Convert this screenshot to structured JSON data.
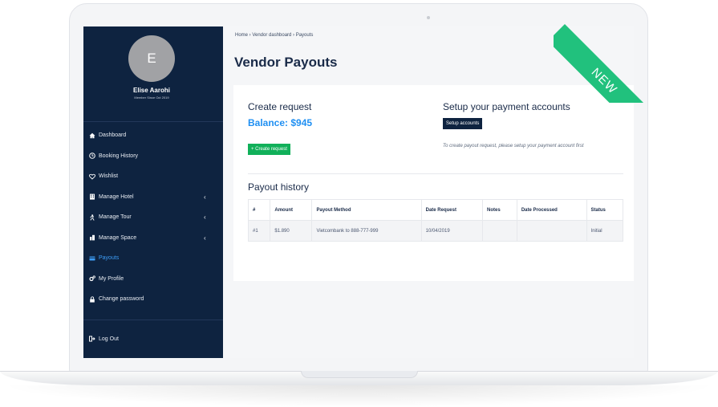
{
  "user": {
    "initial": "E",
    "name": "Elise Aarohi",
    "member_since": "Member Since Oct 2019"
  },
  "sidebar": {
    "items": [
      {
        "label": "Dashboard",
        "icon": "home-icon",
        "caret": false,
        "active": false
      },
      {
        "label": "Booking History",
        "icon": "clock-icon",
        "caret": false,
        "active": false
      },
      {
        "label": "Wishlist",
        "icon": "heart-icon",
        "caret": false,
        "active": false
      },
      {
        "label": "Manage Hotel",
        "icon": "building-icon",
        "caret": true,
        "active": false
      },
      {
        "label": "Manage Tour",
        "icon": "tour-icon",
        "caret": true,
        "active": false
      },
      {
        "label": "Manage Space",
        "icon": "space-icon",
        "caret": true,
        "active": false
      },
      {
        "label": "Payouts",
        "icon": "credit-card-icon",
        "caret": false,
        "active": true
      },
      {
        "label": "My Profile",
        "icon": "cogs-icon",
        "caret": false,
        "active": false
      },
      {
        "label": "Change password",
        "icon": "lock-icon",
        "caret": false,
        "active": false
      }
    ],
    "logout_label": "Log Out",
    "caret_glyph": "‹"
  },
  "breadcrumb": "Home › Vendor dashboard › Payouts",
  "page_title": "Vendor Payouts",
  "request": {
    "title": "Create request",
    "balance": "Balance: $945",
    "button_label": "+ Create request"
  },
  "setup": {
    "title": "Setup your payment accounts",
    "button_label": "Setup accounts",
    "note": "To create payout request, please setup your payment account first"
  },
  "history": {
    "title": "Payout history",
    "columns": [
      "#",
      "Amount",
      "Payout Method",
      "Date Request",
      "Notes",
      "Date Processed",
      "Status"
    ],
    "rows": [
      [
        "#1",
        "$1.890",
        "Vietcombank to 888-777-999",
        "10/04/2019",
        "",
        "",
        "Initial"
      ]
    ]
  },
  "ribbon": "NEW",
  "colors": {
    "sidebar": "#0e2340",
    "accent": "#1f8ff2",
    "success": "#11b05a",
    "ribbon": "#21c17d"
  }
}
